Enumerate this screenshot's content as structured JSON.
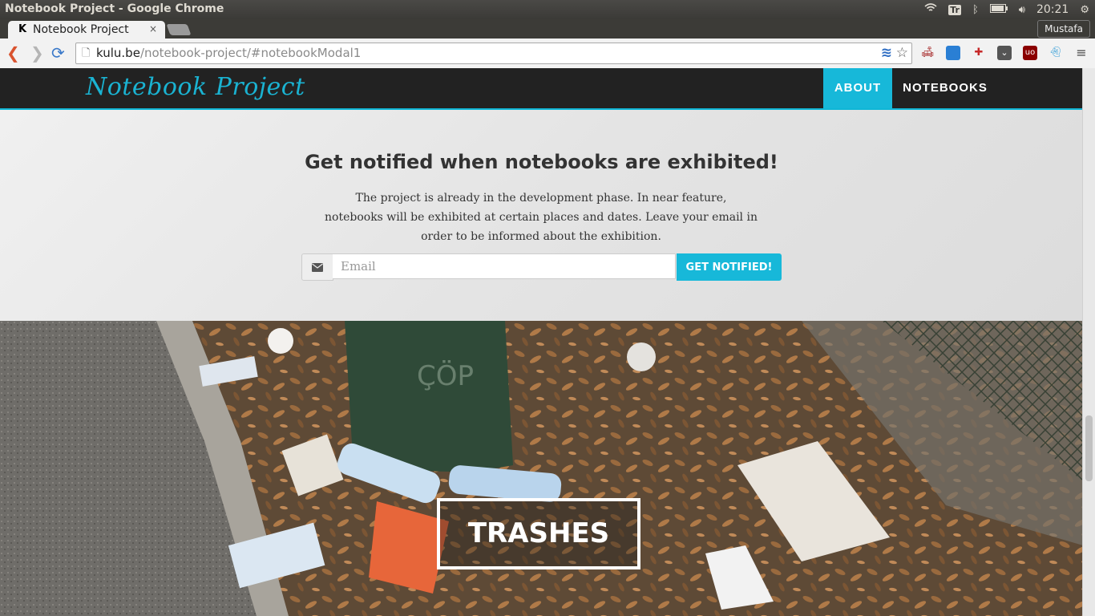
{
  "os": {
    "window_title": "Notebook Project - Google Chrome",
    "tray_tr": "Tr",
    "clock": "20:21"
  },
  "browser": {
    "tab_title": "Notebook Project",
    "tab_favicon": "K",
    "tab_close": "×",
    "user": "Mustafa",
    "url_host": "kulu.be",
    "url_path": "/notebook-project/#notebookModal1"
  },
  "site": {
    "brand": "Notebook Project",
    "nav": {
      "about": "ABOUT",
      "notebooks": "NOTEBOOKS"
    },
    "notify": {
      "heading": "Get notified when notebooks are exhibited!",
      "text": "The project is already in the development phase. In near feature, notebooks will be exhibited at certain places and dates. Leave your email in order to be informed about the exhibition.",
      "email_placeholder": "Email",
      "button": "GET NOTIFIED!"
    },
    "hero_label": "TRASHES"
  },
  "colors": {
    "accent": "#17b8d9",
    "nav_bg": "#222222",
    "notify_bg": "#e6e6e6"
  }
}
